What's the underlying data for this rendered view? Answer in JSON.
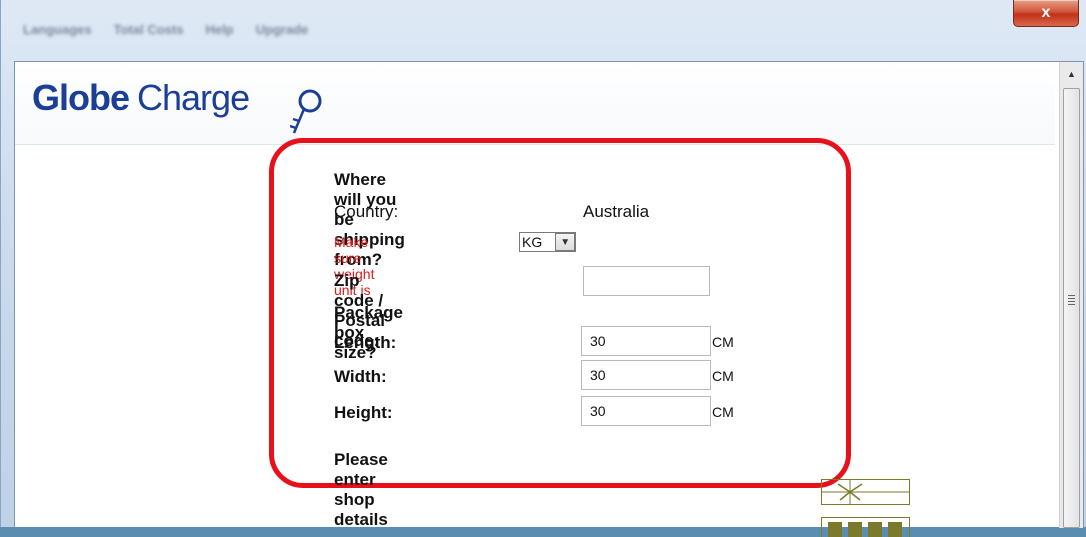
{
  "window": {
    "menu_items": [
      "Languages",
      "Total Costs",
      "Help",
      "Upgrade"
    ],
    "close_label": "x"
  },
  "brand": {
    "part1": "Globe",
    "part2": "Charge",
    "color": "#1b3f96"
  },
  "form": {
    "title": "Where will you be shipping from?",
    "country_label": "Country:",
    "country_value": "Australia",
    "weight_note": "Make sure weight unit is",
    "weight_unit": "KG",
    "zip_label": "Zip code / Postal code:",
    "zip_value": "",
    "box_title": "Package box size?",
    "length_label": "Length:",
    "length_value": "30",
    "length_unit": "CM",
    "width_label": "Width:",
    "width_value": "30",
    "width_unit": "CM",
    "height_label": "Height:",
    "height_value": "30",
    "height_unit": "CM",
    "shop_title": "Please enter shop details"
  },
  "colors": {
    "highlight": "#e8101a",
    "warning_text": "#e01a1a",
    "close_button": "#c2311a"
  }
}
